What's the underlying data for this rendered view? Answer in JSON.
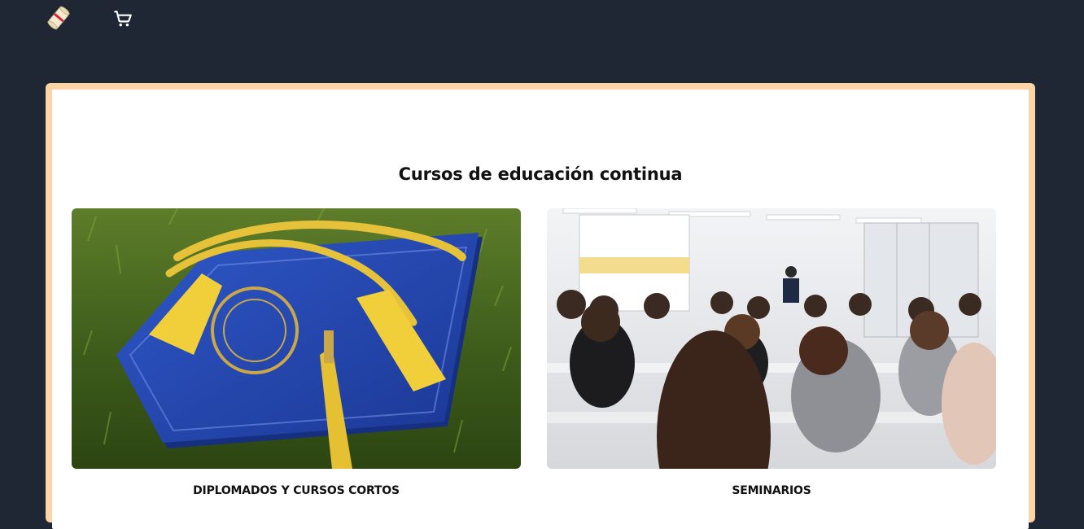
{
  "header": {
    "logo_icon": "diploma-scroll-icon",
    "cart_icon": "shopping-cart-icon"
  },
  "main": {
    "title": "Cursos de educación continua",
    "cards": [
      {
        "label": "DIPLOMADOS Y CURSOS CORTOS",
        "image": "graduation-diploma-photo"
      },
      {
        "label": "SEMINARIOS",
        "image": "seminar-classroom-photo"
      }
    ]
  },
  "colors": {
    "background": "#1f2735",
    "frame": "#fcd4a6",
    "panel": "#ffffff",
    "text": "#111111"
  }
}
